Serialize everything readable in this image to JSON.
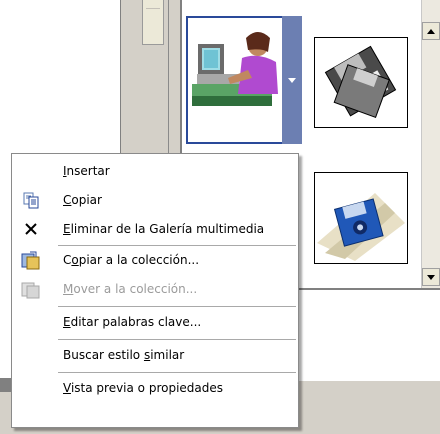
{
  "menu": {
    "items": [
      {
        "key": "insert",
        "pre": "",
        "acc": "I",
        "post": "nsertar",
        "icon": "",
        "enabled": true
      },
      {
        "key": "copy",
        "pre": "",
        "acc": "C",
        "post": "opiar",
        "icon": "copy-icon",
        "enabled": true
      },
      {
        "key": "delete",
        "pre": "",
        "acc": "E",
        "post": "liminar de la Galería multimedia",
        "icon": "delete-x-icon",
        "enabled": true
      },
      {
        "key": "copy_to_collection",
        "pre": "C",
        "acc": "o",
        "post": "piar a la colección...",
        "icon": "copy-to-collection-icon",
        "enabled": true
      },
      {
        "key": "move_to_collection",
        "pre": "",
        "acc": "M",
        "post": "over a la colección...",
        "icon": "move-to-collection-icon",
        "enabled": false
      },
      {
        "key": "edit_keywords",
        "pre": "",
        "acc": "E",
        "post": "ditar palabras clave...",
        "icon": "",
        "enabled": true
      },
      {
        "key": "find_similar",
        "pre": "Buscar estilo ",
        "acc": "s",
        "post": "imilar",
        "icon": "",
        "enabled": true
      },
      {
        "key": "preview",
        "pre": "",
        "acc": "V",
        "post": "ista previa o propiedades",
        "icon": "",
        "enabled": true
      }
    ]
  },
  "gallery": {
    "clips": [
      {
        "name": "computer-user-clipart",
        "selected": true
      },
      {
        "name": "floppy-disks-clipart",
        "selected": false
      },
      {
        "name": "blue-disk-clipart",
        "selected": false
      }
    ]
  },
  "colors": {
    "selection_border": "#2a4a9a",
    "selection_dropdown": "#6c7fb2",
    "disabled_text": "#9b9b9b"
  }
}
